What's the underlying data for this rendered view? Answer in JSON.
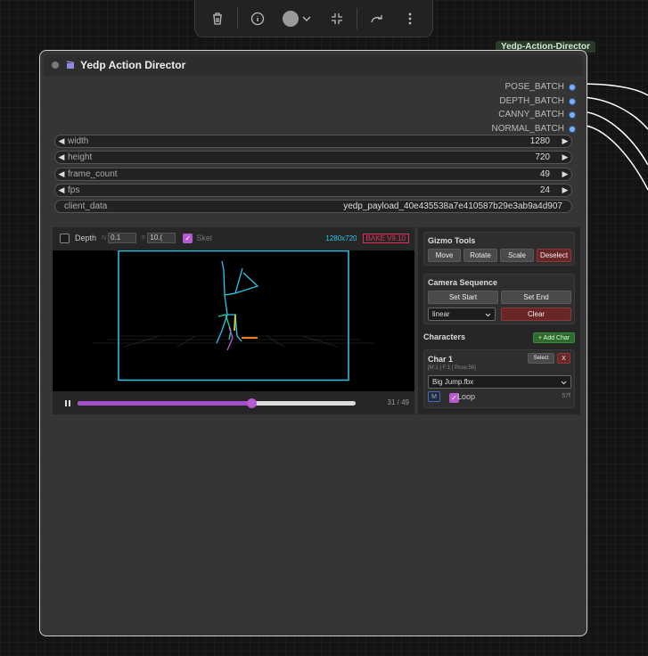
{
  "toolbar": {
    "icons": [
      "trash-icon",
      "info-icon",
      "color-dot-icon",
      "chevron-down-icon",
      "collapse-icon",
      "redo-icon",
      "more-icon"
    ]
  },
  "node": {
    "tag": "Yedp-Action-Director",
    "title": "Yedp Action Director",
    "outputs": [
      "POSE_BATCH",
      "DEPTH_BATCH",
      "CANNY_BATCH",
      "NORMAL_BATCH"
    ],
    "widgets": [
      {
        "label": "width",
        "value": "1280"
      },
      {
        "label": "height",
        "value": "720"
      },
      {
        "label": "frame_count",
        "value": "49"
      },
      {
        "label": "fps",
        "value": "24"
      }
    ],
    "client_data": {
      "label": "client_data",
      "value": "yedp_payload_40e435538a7e410587b29e3ab9a4d907"
    }
  },
  "viewer": {
    "depth_label": "Depth",
    "near_prefix": "N",
    "near_value": "0.1",
    "far_prefix": "F",
    "far_value": "10.(",
    "skel_label": "Skel",
    "skel_checked": true,
    "resolution": "1280x720",
    "bake_label": "BAKE V9.10",
    "frame_counter": "31  /  49",
    "progress": 0.625
  },
  "gizmo": {
    "title": "Gizmo Tools",
    "buttons": [
      "Move",
      "Rotate",
      "Scale",
      "Deselect"
    ]
  },
  "camera": {
    "title": "Camera Sequence",
    "set_start": "Set Start",
    "set_end": "Set End",
    "interp": "linear",
    "clear": "Clear"
  },
  "characters": {
    "title": "Characters",
    "add_label": "+ Add Char",
    "items": [
      {
        "name": "Char 1",
        "meta": "[M:1 | F:1 | Pose:56]",
        "select": "Select",
        "remove": "X",
        "animation": "Big Jump.fbx",
        "m_label": "M",
        "loop_label": "Loop",
        "frames": "57f"
      }
    ]
  },
  "colors": {
    "accent": "#b55ad0",
    "cyan": "#2ec5e8",
    "danger": "#6a2626",
    "add": "#2e6a2e"
  }
}
